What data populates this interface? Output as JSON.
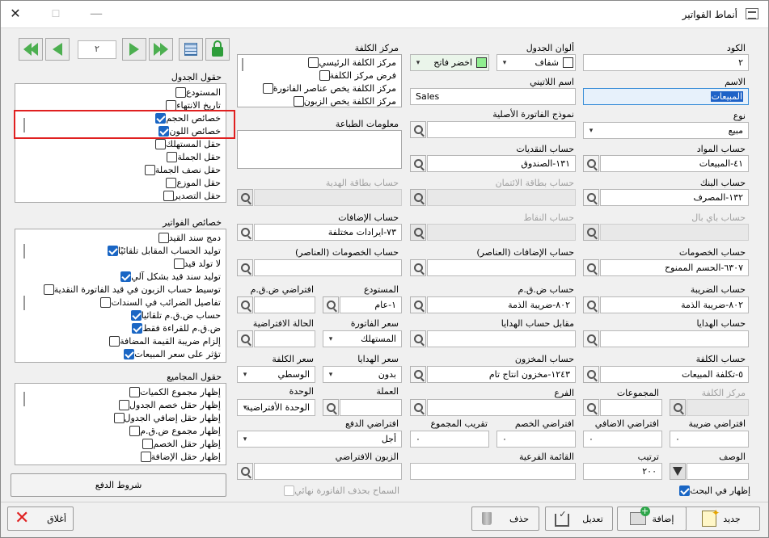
{
  "window": {
    "title": "أنماط الفواتير",
    "minimize": "—",
    "maximize": "☐",
    "close": "✕"
  },
  "nav": {
    "record_number": "٢"
  },
  "fields": {
    "code": {
      "label": "الكود",
      "value": "٢"
    },
    "name": {
      "label": "الاسم",
      "value": "المبيعات"
    },
    "type": {
      "label": "نوع",
      "value": "مبيع"
    },
    "materials_account": {
      "label": "حساب المواد",
      "value": "٤١-المبيعات"
    },
    "bank_account": {
      "label": "حساب البنك",
      "value": "١٣٢-المصرف"
    },
    "paypal_account": {
      "label": "حساب باي بال",
      "value": ""
    },
    "discounts_account": {
      "label": "حساب الخصومات",
      "value": "٦٣٠٧-الحسم الممنوح"
    },
    "tax_account": {
      "label": "حساب الضريبة",
      "value": "٨٠٢-ضريبة الذمة"
    },
    "gifts_account": {
      "label": "حساب الهدايا",
      "value": ""
    },
    "cost_account": {
      "label": "حساب الكلفة",
      "value": "٥-تكلفة المبيعات"
    },
    "cost_center2": {
      "label": "مركز الكلفة",
      "value": ""
    },
    "groups": {
      "label": "المجموعات",
      "value": ""
    },
    "default_tax": {
      "label": "افتراضي ضريبة",
      "value": "٠"
    },
    "default_addition": {
      "label": "افتراضي الاضافي",
      "value": "٠"
    },
    "description": {
      "label": "الوصف",
      "value": ""
    },
    "order": {
      "label": "ترتيب",
      "value": "٢٠٠"
    },
    "show_in_search": {
      "label": "إظهار في البحث",
      "checked": true
    },
    "table_colors": {
      "label": "ألوان الجدول",
      "value1": "شفاف",
      "value2": "اخضر فاتح",
      "color1": "#ffffff",
      "color2": "#90ee90"
    },
    "latin_name": {
      "label": "اسم اللاتيني",
      "value": "Sales"
    },
    "original_invoice_model": {
      "label": "نموذج الفاتورة الأصلية",
      "value": ""
    },
    "cash_account": {
      "label": "حساب النقديات",
      "value": "١٣١-الصندوق"
    },
    "credit_card_account": {
      "label": "حساب بطاقة الائتمان",
      "value": ""
    },
    "points_account": {
      "label": "حساب النقاط",
      "value": ""
    },
    "additions_items_account": {
      "label": "حساب الإضافات (العناصر)",
      "value": ""
    },
    "tax_vat_account": {
      "label": "حساب ض.ق.م",
      "value": "٨٠٢-ضريبة الذمة"
    },
    "gifts_counter_account": {
      "label": "مقابل حساب الهدايا",
      "value": ""
    },
    "stock_account": {
      "label": "حساب المخزون",
      "value": "١٢٤٣-مخزون انتاج تام"
    },
    "branch": {
      "label": "الفرع",
      "value": ""
    },
    "default_discount": {
      "label": "افتراضي الخصم",
      "value": "٠"
    },
    "total_rounding": {
      "label": "تقريب المجموع",
      "value": "٠"
    },
    "sub_list": {
      "label": "القائمة الفرعية",
      "value": ""
    },
    "cost_center": {
      "label": "مركز الكلفة",
      "options": [
        {
          "label": "مركز الكلفة الرئيسي",
          "checked": false
        },
        {
          "label": "فرض مركز الكلفة",
          "checked": false
        },
        {
          "label": "مركز الكلفة يخص عناصر الفاتورة",
          "checked": false
        },
        {
          "label": "مركز الكلفة يخص الزبون",
          "checked": false
        }
      ]
    },
    "print_info": {
      "label": "معلومات الطباعة",
      "value": ""
    },
    "gift_card_account": {
      "label": "حساب بطاقة الهدية",
      "value": ""
    },
    "additions_account": {
      "label": "حساب الإضافات",
      "value": "٧٣-ايرادات مختلفة"
    },
    "discounts_items_account": {
      "label": "حساب الخصومات (العناصر)",
      "value": ""
    },
    "warehouse": {
      "label": "المستودع",
      "value": "١-عام"
    },
    "default_vat": {
      "label": "افتراضي ض.ق.م",
      "value": ""
    },
    "invoice_price": {
      "label": "سعر الفاتورة",
      "value": "المستهلك"
    },
    "default_state": {
      "label": "الحالة الافتراضية",
      "value": ""
    },
    "gifts_price": {
      "label": "سعر الهدايا",
      "value": "بدون"
    },
    "cost_price": {
      "label": "سعر الكلفة",
      "value": "الوسطي"
    },
    "currency": {
      "label": "العملة",
      "value": ""
    },
    "unit": {
      "label": "الوحدة",
      "value": "الوحدة الأفتراضية"
    },
    "default_payment": {
      "label": "افتراضي الدفع",
      "value": "أجل"
    },
    "default_customer": {
      "label": "الزبون الافتراضي",
      "value": ""
    },
    "allow_delete_final": {
      "label": "السماح بحذف الفاتورة نهائي",
      "checked": false
    }
  },
  "table_fields": {
    "title": "حقول الجدول",
    "items": [
      {
        "label": "المستودع",
        "checked": false
      },
      {
        "label": "تاريخ الانتهاء",
        "checked": false
      },
      {
        "label": "خصائص الحجم",
        "checked": true
      },
      {
        "label": "خصائص اللون",
        "checked": true
      },
      {
        "label": "حقل المستهلك",
        "checked": false
      },
      {
        "label": "حقل الجملة",
        "checked": false
      },
      {
        "label": "حقل نصف الجملة",
        "checked": false
      },
      {
        "label": "حقل الموزع",
        "checked": false
      },
      {
        "label": "حقل التصدير",
        "checked": false
      }
    ]
  },
  "invoice_props": {
    "title": "خصائص الفواتير",
    "items": [
      {
        "label": "دمج سند القيد",
        "checked": false
      },
      {
        "label": "توليد الحساب المقابل تلقائيًا",
        "checked": true
      },
      {
        "label": "لا تولد قيد",
        "checked": false
      },
      {
        "label": "توليد سند قيد بشكل آلي",
        "checked": true
      },
      {
        "label": "توسيط حساب الزبون في قيد الفاتورة النقدية",
        "checked": false
      },
      {
        "label": "تفاصيل الضرائب في السندات",
        "checked": false
      },
      {
        "label": "حساب ض.ق.م تلقائيا",
        "checked": true
      },
      {
        "label": "ض.ق.م للقراءة فقط",
        "checked": true
      },
      {
        "label": "إلزام ضريبة القيمة المضافة",
        "checked": false
      },
      {
        "label": "تؤثر على سعر المبيعات",
        "checked": true
      }
    ]
  },
  "totals_fields": {
    "title": "حقول المجاميع",
    "items": [
      {
        "label": "إظهار مجموع الكميات",
        "checked": false
      },
      {
        "label": "إظهار حقل خصم الجدول",
        "checked": false
      },
      {
        "label": "إظهار حقل إضافي الجدول",
        "checked": false
      },
      {
        "label": "إظهار مجموع ض.ق.م",
        "checked": false
      },
      {
        "label": "إظهار حقل الخصم",
        "checked": false
      },
      {
        "label": "إظهار حقل الإضافة",
        "checked": false
      }
    ]
  },
  "buttons": {
    "payment_terms": "شروط الدفع",
    "new": "جديد",
    "add": "إضافة",
    "edit": "تعديل",
    "delete": "حذف",
    "close": "أغلاق"
  }
}
